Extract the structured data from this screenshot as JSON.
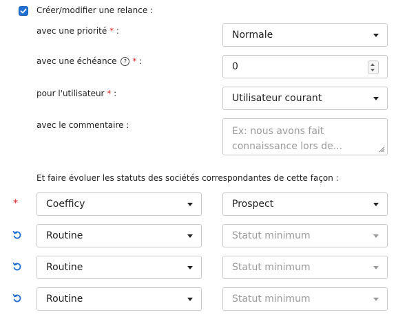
{
  "form": {
    "create_checkbox_label": "Créer/modifier une relance :",
    "create_checked": true,
    "priority": {
      "label": "avec une priorité",
      "required_mark": "*",
      "suffix": ":",
      "value": "Normale"
    },
    "deadline": {
      "label": "avec une échéance",
      "help_icon": "help-circle-icon",
      "help_glyph": "?",
      "required_mark": "*",
      "suffix": ":",
      "value": "0"
    },
    "user": {
      "label": "pour l'utilisateur",
      "required_mark": "*",
      "suffix": ":",
      "value": "Utilisateur courant"
    },
    "comment": {
      "label": "avec le commentaire :",
      "placeholder": "Ex: nous avons fait connaissance lors de..."
    },
    "status_section_title": "Et faire évoluer les statuts des sociétés correspondantes de cette façon :",
    "status_rows": [
      {
        "marker": "*",
        "marker_type": "required",
        "left": "Coefficy",
        "right": "Prospect",
        "right_is_placeholder": false
      },
      {
        "marker": "reset-icon",
        "marker_type": "icon",
        "left": "Routine",
        "right": "Statut minimum",
        "right_is_placeholder": true
      },
      {
        "marker": "reset-icon",
        "marker_type": "icon",
        "left": "Routine",
        "right": "Statut minimum",
        "right_is_placeholder": true
      },
      {
        "marker": "reset-icon",
        "marker_type": "icon",
        "left": "Routine",
        "right": "Statut minimum",
        "right_is_placeholder": true
      }
    ]
  },
  "colors": {
    "accent": "#1f6fd1",
    "required": "#e02020",
    "placeholder": "#9a9a9a",
    "border": "#c9c9c9"
  }
}
